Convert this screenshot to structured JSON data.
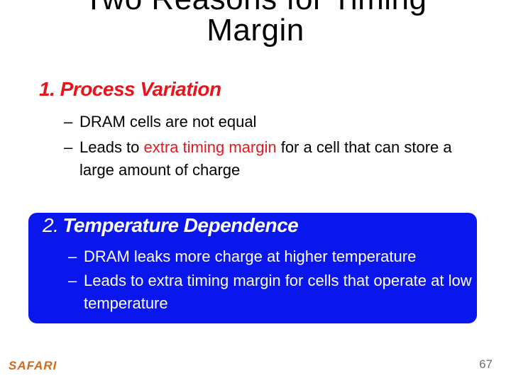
{
  "slide": {
    "title_line1": "Two Reasons for Timing",
    "title_line2": "Margin",
    "section1": {
      "heading": "1. Process Variation",
      "heading_color": "#e8141c",
      "bullets": [
        {
          "dash": "–",
          "text": "DRAM cells are not equal"
        },
        {
          "dash": "–",
          "before": "Leads to ",
          "highlight": "extra timing margin",
          "after": " for a cell that can store a large amount of charge"
        }
      ]
    },
    "section2": {
      "number": "2.",
      "heading": "Temperature Dependence",
      "box_color": "#0a16ee",
      "bullets": [
        {
          "dash": "–",
          "text": "DRAM leaks more charge at higher temperature"
        },
        {
          "dash": "–",
          "text": "Leads to extra timing margin for cells that operate at low temperature"
        }
      ]
    },
    "footer": {
      "logo": "SAFARI",
      "logo_color": "#d2691e",
      "page_number": "67"
    }
  }
}
